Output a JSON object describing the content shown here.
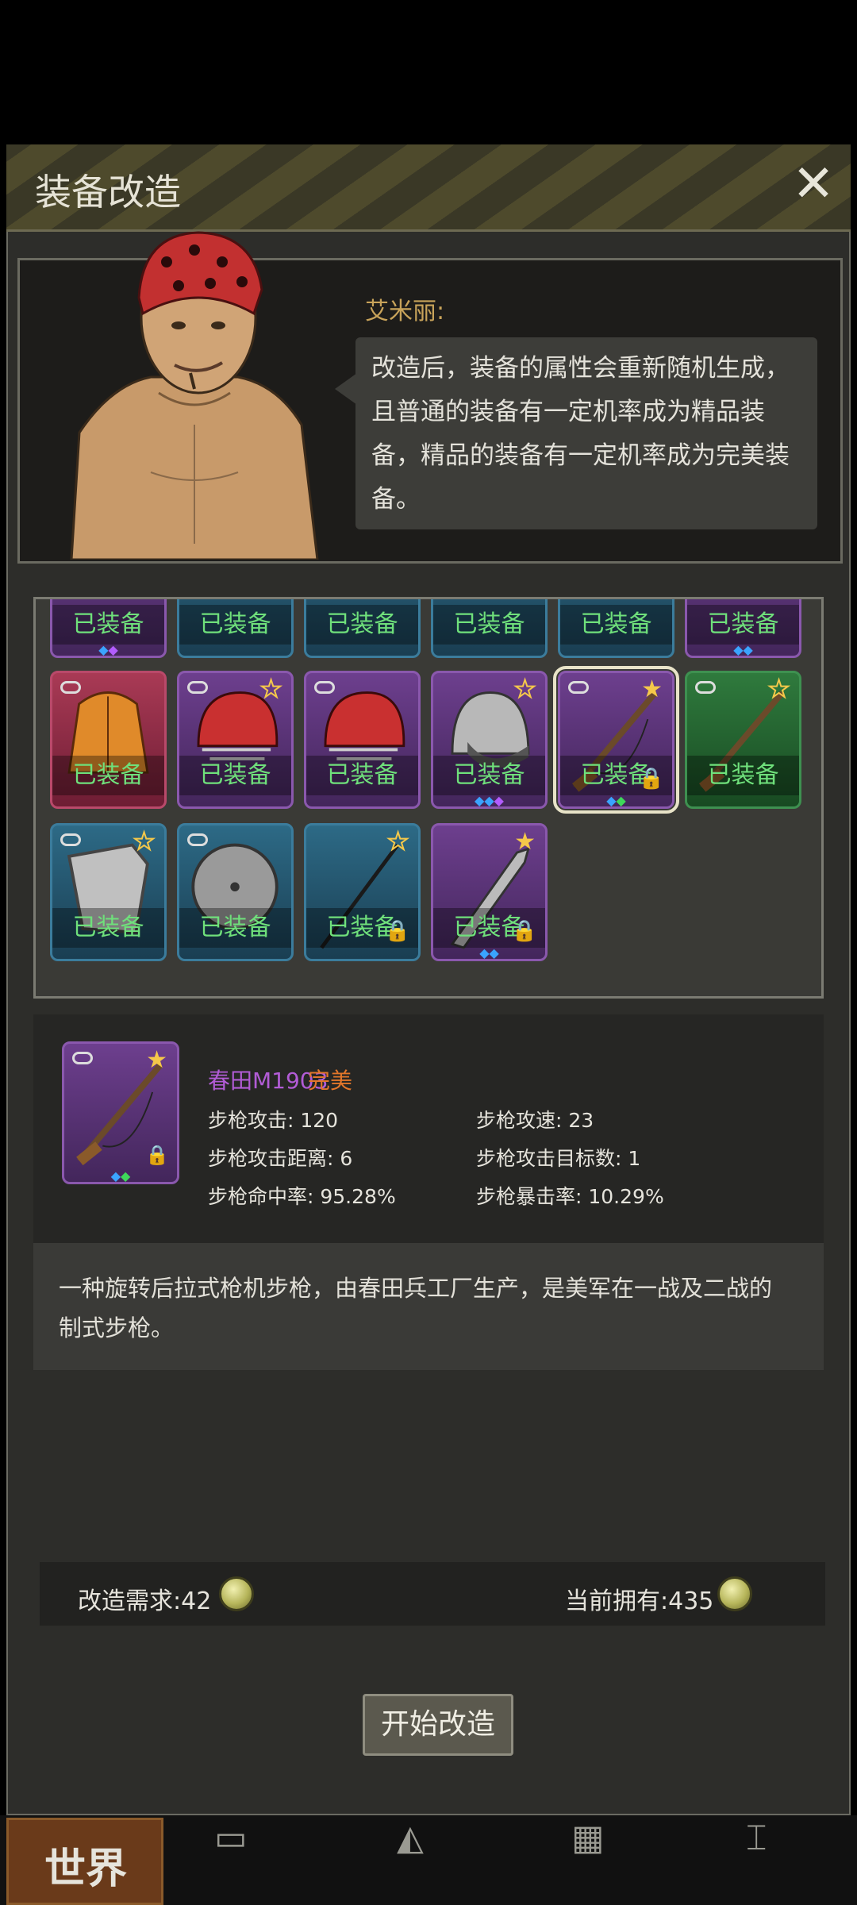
{
  "header": {
    "title": "装备改造",
    "close_label": "✕"
  },
  "npc": {
    "name": "艾米丽:",
    "speech": "改造后，装备的属性会重新随机生成，且普通的装备有一定机率成为精品装备，精品的装备有一定机率成为完美装备。"
  },
  "inventory": {
    "equipped_label": "已装备",
    "rows": [
      [
        {
          "item": "partial-item",
          "color": "purple"
        },
        {
          "item": "partial-item",
          "color": "blue"
        },
        {
          "item": "partial-item",
          "color": "blue"
        },
        {
          "item": "partial-item",
          "color": "blue"
        },
        {
          "item": "partial-item",
          "color": "blue"
        },
        {
          "item": "partial-item",
          "color": "purple"
        }
      ],
      [
        {
          "item": "yellow-jacket",
          "color": "red"
        },
        {
          "item": "football-helmet",
          "color": "purple"
        },
        {
          "item": "football-helmet",
          "color": "purple"
        },
        {
          "item": "police-helmet",
          "color": "purple"
        },
        {
          "item": "springfield-rifle",
          "color": "purple",
          "selected": true
        },
        {
          "item": "rifle",
          "color": "green"
        }
      ],
      [
        {
          "item": "shield",
          "color": "blue"
        },
        {
          "item": "round-shield",
          "color": "blue"
        },
        {
          "item": "spear",
          "color": "blue"
        },
        {
          "item": "machete",
          "color": "purple"
        }
      ]
    ]
  },
  "detail": {
    "name": "春田M1903",
    "quality": "完美",
    "stats": [
      {
        "label": "步枪攻击: 120"
      },
      {
        "label": "步枪攻速: 23"
      },
      {
        "label": "步枪攻击距离: 6"
      },
      {
        "label": "步枪攻击目标数: 1"
      },
      {
        "label": "步枪命中率: 95.28%"
      },
      {
        "label": "步枪暴击率: 10.29%"
      }
    ],
    "description": "一种旋转后拉式枪机步枪，由春田兵工厂生产，是美军在一战及二战的制式步枪。"
  },
  "cost": {
    "required_label": "改造需求:42",
    "owned_label": "当前拥有:435",
    "currency_icon": "coin-icon"
  },
  "start_button": "开始改造",
  "nav": {
    "world_label": "世界"
  },
  "colors": {
    "equipped_text": "#6fe07b",
    "quality_perfect": "#e2762a",
    "item_name_purple": "#b25cd6",
    "npc_name": "#c8a35a"
  }
}
